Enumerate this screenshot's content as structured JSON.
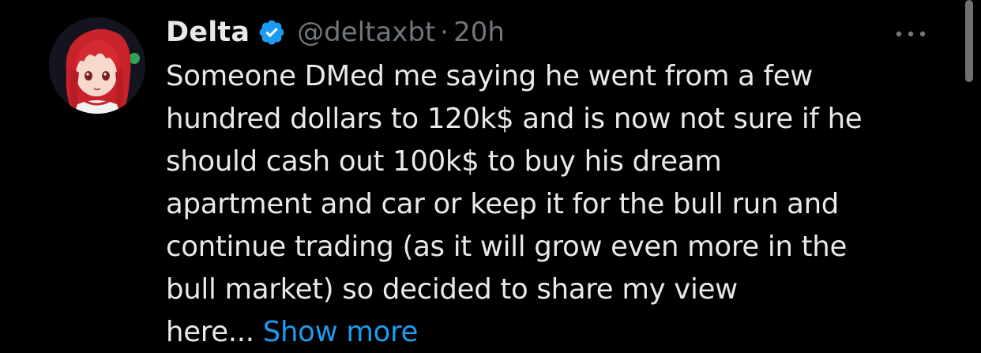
{
  "tweet": {
    "author_name": "Delta",
    "verified": true,
    "handle": "@deltaxbt",
    "separator": "·",
    "time": "20h",
    "more_icon": "ellipsis-icon",
    "text_lines": [
      "Someone DMed me saying he went from a few",
      "hundred dollars to 120k$ and is now not sure if he",
      "should cash out 100k$ to buy his dream",
      "apartment and car or keep it for the bull run and",
      "continue trading (as it will grow even more in the",
      "bull market) so decided to share my view",
      "here..."
    ],
    "show_more_label": "Show more"
  },
  "colors": {
    "background": "#000000",
    "primary_text": "#e7e9ea",
    "secondary_text": "#71767b",
    "accent": "#1d9bf0"
  }
}
